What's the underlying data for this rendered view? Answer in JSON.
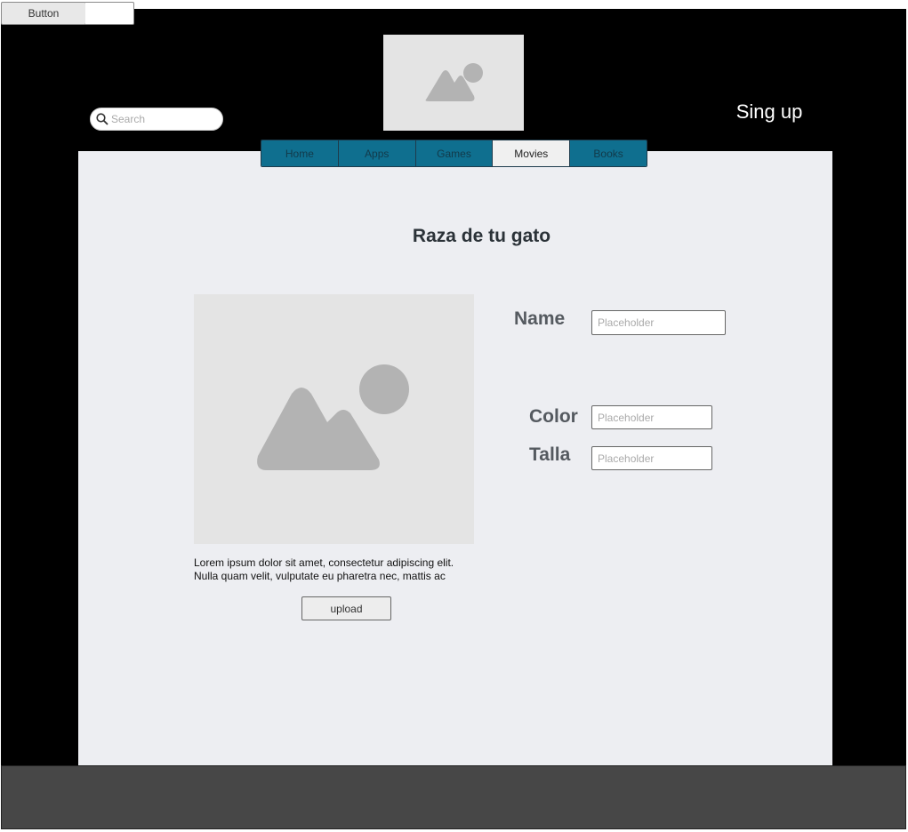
{
  "top_button": {
    "label": "Button"
  },
  "search": {
    "placeholder": "Search"
  },
  "header": {
    "signup_label": "Sing up"
  },
  "nav": {
    "tabs": [
      {
        "label": "Home"
      },
      {
        "label": "Apps"
      },
      {
        "label": "Games"
      },
      {
        "label": "Movies"
      },
      {
        "label": "Books"
      }
    ],
    "active": "Movies"
  },
  "main": {
    "title": "Raza de tu gato",
    "description": "Lorem ipsum dolor sit amet, consectetur adipiscing elit. Nulla quam velit, vulputate eu pharetra nec, mattis ac neque. Duis vulputate commodo lectus, ac blandit elit tincidunt id. Sed",
    "upload_label": "upload"
  },
  "form": {
    "name": {
      "label": "Name",
      "placeholder": "Placeholder"
    },
    "color": {
      "label": "Color",
      "placeholder": "Placeholder"
    },
    "talla": {
      "label": "Talla",
      "placeholder": "Placeholder"
    }
  },
  "icons": {
    "logo": "image-placeholder-icon",
    "search": "search-icon",
    "main_image": "image-placeholder-icon"
  },
  "colors": {
    "frame": "#000000",
    "panel": "#edeef2",
    "tab": "#0f6f8f",
    "tab_active": "#f0f0f0",
    "footer": "#474747"
  }
}
